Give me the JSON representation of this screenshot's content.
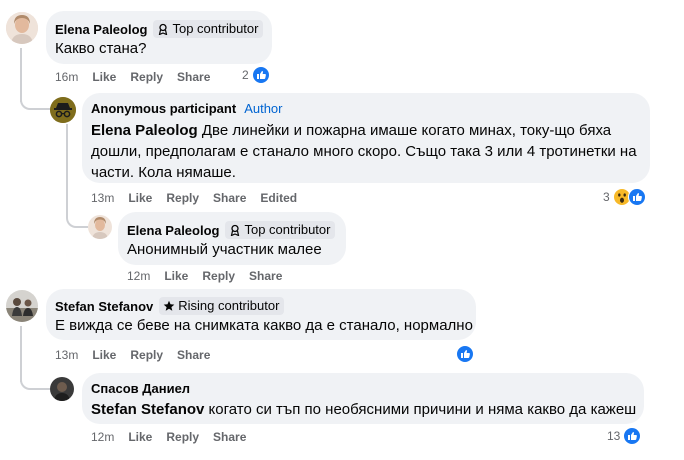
{
  "comments": [
    {
      "author": "Elena Paleolog",
      "badge": "Top contributor",
      "text": "Какво стана?",
      "time": "16m",
      "like": "Like",
      "reply": "Reply",
      "share": "Share",
      "reaction_count": "2"
    },
    {
      "author": "Anonymous participant",
      "author_tag": "Author",
      "mention": "Elena Paleolog",
      "text": " Две линейки и пожарна имаше когато минах, току-що бяха дошли, предполагам е станало много скоро. Също така 3 или 4 тротинетки на части. Кола нямаше.",
      "time": "13m",
      "like": "Like",
      "reply": "Reply",
      "share": "Share",
      "edited": "Edited",
      "reaction_count": "3"
    },
    {
      "author": "Elena Paleolog",
      "badge": "Top contributor",
      "text": "Анонимный участник малее",
      "time": "12m",
      "like": "Like",
      "reply": "Reply",
      "share": "Share"
    },
    {
      "author": "Stefan Stefanov",
      "badge": "Rising contributor",
      "text": "Е вижда се беве на снимката какво да е станало, нормално",
      "time": "13m",
      "like": "Like",
      "reply": "Reply",
      "share": "Share"
    },
    {
      "author": "Спасов Даниел",
      "mention": "Stefan Stefanov",
      "text": " когато си тъп по необясними причини и няма какво да кажеш",
      "time": "12m",
      "like": "Like",
      "reply": "Reply",
      "share": "Share",
      "reaction_count": "13"
    }
  ],
  "icons": {
    "like": "like-reaction-icon",
    "wow": "wow-reaction-icon",
    "top_contributor": "contributor-badge-icon",
    "rising_contributor": "star-icon",
    "anonymous": "incognito-icon"
  },
  "colors": {
    "like_blue": "#1877f2",
    "wow_yellow": "#f7b928",
    "author_tag": "#0064d1",
    "bubble": "#f0f2f5",
    "meta_text": "#65676b"
  }
}
